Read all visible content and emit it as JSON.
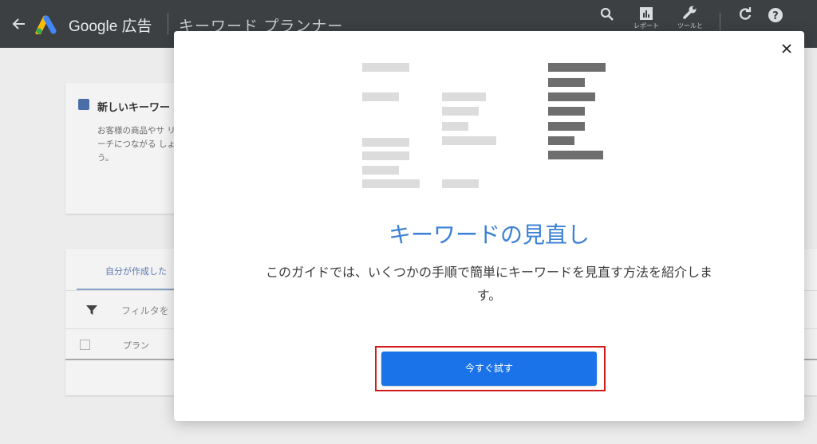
{
  "appbar": {
    "brand": "Google 広告",
    "page_title": "キーワード プランナー",
    "tools": [
      {
        "icon": "search-icon",
        "label": ""
      },
      {
        "icon": "reports-icon",
        "label": "レポート"
      },
      {
        "icon": "wrench-icon",
        "label": "ツールと"
      },
      {
        "icon": "refresh-icon",
        "label": ""
      },
      {
        "icon": "help-icon",
        "label": ""
      }
    ]
  },
  "background": {
    "keyword_card": {
      "title": "新しいキーワー",
      "description": "お客様の商品やサ リーチにつながる しょう。"
    },
    "plans_card": {
      "tab_label": "自分が作成した",
      "filter_label": "フィルタを",
      "column_plan": "プラン"
    }
  },
  "modal": {
    "title": "キーワードの見直し",
    "body": "このガイドでは、いくつかの手順で簡単にキーワードを見直す方法を紹介します。",
    "cta_label": "今すぐ試す"
  },
  "colors": {
    "appbar_bg": "#3c4043",
    "accent_blue": "#1a73e8",
    "title_blue": "#3a80d4",
    "highlight_red": "#d11a1a"
  }
}
